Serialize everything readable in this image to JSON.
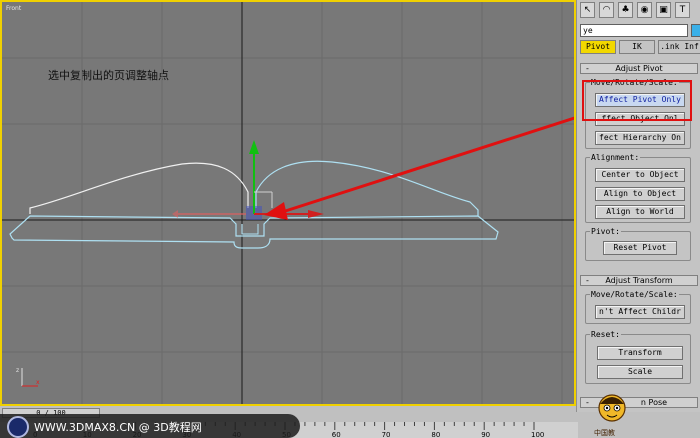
{
  "viewport": {
    "label": "Front",
    "annotation": "选中复制出的页调整轴点"
  },
  "toolbar": {
    "icons": [
      {
        "name": "select-icon",
        "glyph": "↖"
      },
      {
        "name": "modify-icon",
        "glyph": "◠"
      },
      {
        "name": "hierarchy-icon",
        "glyph": "♣"
      },
      {
        "name": "motion-icon",
        "glyph": "◉"
      },
      {
        "name": "display-icon",
        "glyph": "▣"
      },
      {
        "name": "utilities-icon",
        "glyph": "T"
      }
    ]
  },
  "object_name": "ye",
  "colors": {
    "object_color": "#3ab0e8",
    "highlight": "#e01010",
    "active_tab": "#f2d800",
    "viewport_border": "#f0d000"
  },
  "tabs": [
    "Pivot",
    "IK",
    ".ink Inf"
  ],
  "adjust_pivot": {
    "title": "Adjust Pivot",
    "move_label": "Move/Rotate/Scale:",
    "buttons": [
      "Affect Pivot Only",
      "ffect Object Onl",
      "fect Hierarchy On"
    ],
    "alignment_label": "Alignment:",
    "align_buttons": [
      "Center to Object",
      "Align to Object",
      "Align to World"
    ],
    "pivot_label": "Pivot:",
    "reset_pivot": "Reset Pivot"
  },
  "adjust_transform": {
    "title": "Adjust Transform",
    "move_label": "Move/Rotate/Scale:",
    "button": "n't Affect Childr",
    "reset_label": "Reset:",
    "reset_buttons": [
      "Transform",
      "Scale"
    ]
  },
  "skin_pose": {
    "title": "n Pose"
  },
  "mascot_text": "中国教",
  "timeline": {
    "frame": "0 / 100",
    "ticks": [
      "0",
      "10",
      "20",
      "30",
      "40",
      "50",
      "60",
      "70",
      "80",
      "90",
      "100"
    ]
  },
  "watermark": "WWW.3DMAX8.CN @ 3D教程网"
}
